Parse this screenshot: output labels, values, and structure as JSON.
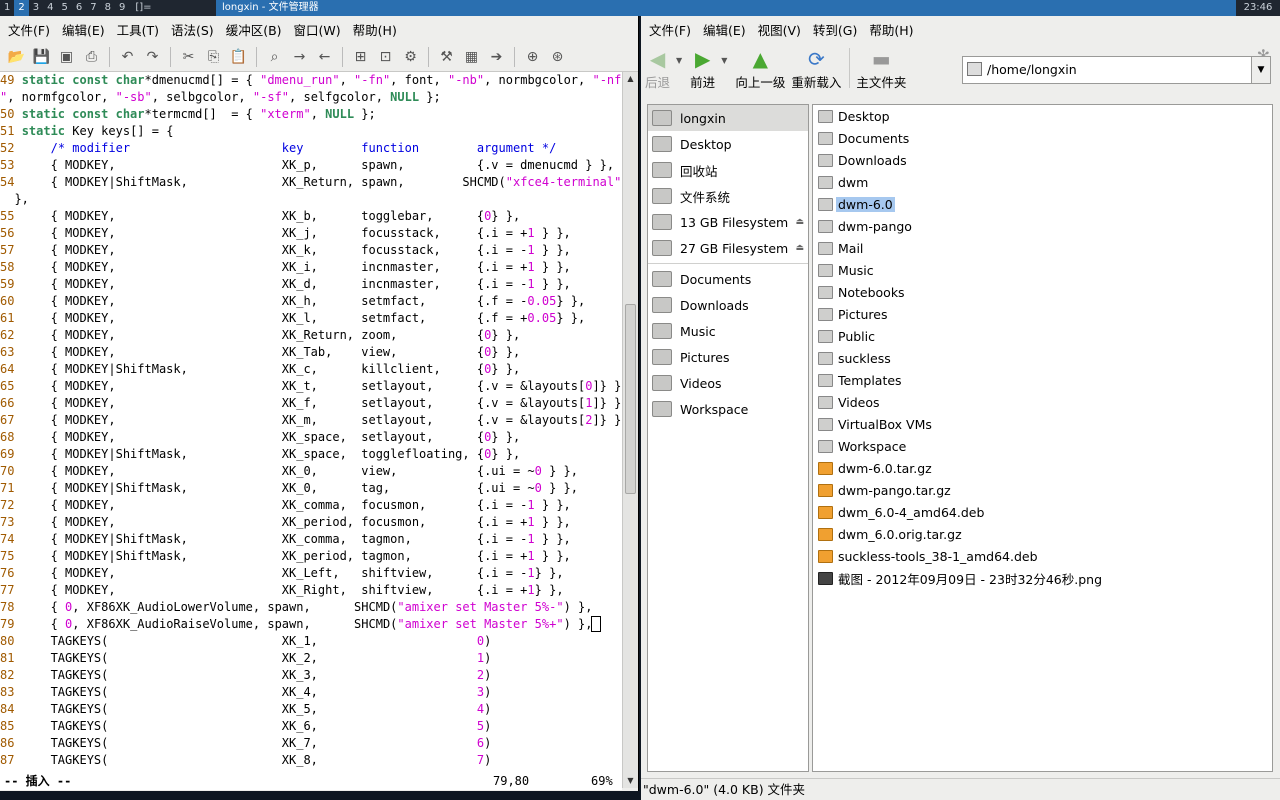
{
  "topbar": {
    "tags": [
      "1",
      "2",
      "3",
      "4",
      "5",
      "6",
      "7",
      "8",
      "9"
    ],
    "selected_tag": "2",
    "layout_symbol": "[]=",
    "window_title": "longxin - 文件管理器",
    "clock": "23:46"
  },
  "editor": {
    "menu": [
      "文件(F)",
      "编辑(E)",
      "工具(T)",
      "语法(S)",
      "缓冲区(B)",
      "窗口(W)",
      "帮助(H)"
    ],
    "toolbar_icons": [
      "open-icon",
      "save-icon",
      "save-all-icon",
      "print-icon",
      "undo-icon",
      "redo-icon",
      "cut-icon",
      "copy-icon",
      "paste-icon",
      "find-replace-icon",
      "find-next-icon",
      "find-prev-icon",
      "load-session-icon",
      "save-session-icon",
      "run-script-icon",
      "make-icon",
      "run-ctags-icon",
      "jump-tag-icon",
      "help-icon",
      "find-help-icon"
    ],
    "code_lines": [
      [
        [
          "ln",
          "49 "
        ],
        [
          "kw",
          "static const char"
        ],
        [
          "",
          "*dmenucmd[] = { "
        ],
        [
          "st",
          "\"dmenu_run\""
        ],
        [
          "",
          ", "
        ],
        [
          "st",
          "\"-fn\""
        ],
        [
          "",
          ", font, "
        ],
        [
          "st",
          "\"-nb\""
        ],
        [
          "",
          ", normbgcolor, "
        ],
        [
          "st",
          "\"-nf"
        ]
      ],
      [
        [
          "st",
          "\""
        ],
        [
          "",
          ", normfgcolor, "
        ],
        [
          "st",
          "\"-sb\""
        ],
        [
          "",
          ", selbgcolor, "
        ],
        [
          "st",
          "\"-sf\""
        ],
        [
          "",
          ", selfgcolor, "
        ],
        [
          "kw",
          "NULL"
        ],
        [
          "",
          " };"
        ]
      ],
      [
        [
          "ln",
          "50 "
        ],
        [
          "kw",
          "static const char"
        ],
        [
          "",
          "*termcmd[]  = { "
        ],
        [
          "st",
          "\"xterm\""
        ],
        [
          "",
          ", "
        ],
        [
          "kw",
          "NULL"
        ],
        [
          "",
          " };"
        ]
      ],
      [
        [
          "ln",
          "51 "
        ],
        [
          "kw",
          "static"
        ],
        [
          "",
          " Key keys[] = {"
        ]
      ],
      [
        [
          "ln",
          "52 "
        ],
        [
          "",
          "    "
        ],
        [
          "cm",
          "/* modifier                     key        function        argument */"
        ]
      ],
      [
        [
          "ln",
          "53 "
        ],
        [
          "",
          "    { MODKEY,                       XK_p,      spawn,          {.v = dmenucmd } },"
        ]
      ],
      [
        [
          "ln",
          "54 "
        ],
        [
          "",
          "    { MODKEY|ShiftMask,             XK_Return, spawn,        SHCMD("
        ],
        [
          "st",
          "\"xfce4-terminal\""
        ],
        [
          "",
          ")"
        ]
      ],
      [
        [
          "",
          "  },"
        ]
      ],
      [
        [
          "ln",
          "55 "
        ],
        [
          "",
          "    { MODKEY,                       XK_b,      togglebar,      {"
        ],
        [
          "nu",
          "0"
        ],
        [
          "",
          "} },"
        ]
      ],
      [
        [
          "ln",
          "56 "
        ],
        [
          "",
          "    { MODKEY,                       XK_j,      focusstack,     {.i = +"
        ],
        [
          "nu",
          "1"
        ],
        [
          "",
          " } },"
        ]
      ],
      [
        [
          "ln",
          "57 "
        ],
        [
          "",
          "    { MODKEY,                       XK_k,      focusstack,     {.i = -"
        ],
        [
          "nu",
          "1"
        ],
        [
          "",
          " } },"
        ]
      ],
      [
        [
          "ln",
          "58 "
        ],
        [
          "",
          "    { MODKEY,                       XK_i,      incnmaster,     {.i = +"
        ],
        [
          "nu",
          "1"
        ],
        [
          "",
          " } },"
        ]
      ],
      [
        [
          "ln",
          "59 "
        ],
        [
          "",
          "    { MODKEY,                       XK_d,      incnmaster,     {.i = -"
        ],
        [
          "nu",
          "1"
        ],
        [
          "",
          " } },"
        ]
      ],
      [
        [
          "ln",
          "60 "
        ],
        [
          "",
          "    { MODKEY,                       XK_h,      setmfact,       {.f = -"
        ],
        [
          "nu",
          "0.05"
        ],
        [
          "",
          "} },"
        ]
      ],
      [
        [
          "ln",
          "61 "
        ],
        [
          "",
          "    { MODKEY,                       XK_l,      setmfact,       {.f = +"
        ],
        [
          "nu",
          "0.05"
        ],
        [
          "",
          "} },"
        ]
      ],
      [
        [
          "ln",
          "62 "
        ],
        [
          "",
          "    { MODKEY,                       XK_Return, zoom,           {"
        ],
        [
          "nu",
          "0"
        ],
        [
          "",
          "} },"
        ]
      ],
      [
        [
          "ln",
          "63 "
        ],
        [
          "",
          "    { MODKEY,                       XK_Tab,    view,           {"
        ],
        [
          "nu",
          "0"
        ],
        [
          "",
          "} },"
        ]
      ],
      [
        [
          "ln",
          "64 "
        ],
        [
          "",
          "    { MODKEY|ShiftMask,             XK_c,      killclient,     {"
        ],
        [
          "nu",
          "0"
        ],
        [
          "",
          "} },"
        ]
      ],
      [
        [
          "ln",
          "65 "
        ],
        [
          "",
          "    { MODKEY,                       XK_t,      setlayout,      {.v = &layouts["
        ],
        [
          "nu",
          "0"
        ],
        [
          "",
          "]} },"
        ]
      ],
      [
        [
          "ln",
          "66 "
        ],
        [
          "",
          "    { MODKEY,                       XK_f,      setlayout,      {.v = &layouts["
        ],
        [
          "nu",
          "1"
        ],
        [
          "",
          "]} },"
        ]
      ],
      [
        [
          "ln",
          "67 "
        ],
        [
          "",
          "    { MODKEY,                       XK_m,      setlayout,      {.v = &layouts["
        ],
        [
          "nu",
          "2"
        ],
        [
          "",
          "]} },"
        ]
      ],
      [
        [
          "ln",
          "68 "
        ],
        [
          "",
          "    { MODKEY,                       XK_space,  setlayout,      {"
        ],
        [
          "nu",
          "0"
        ],
        [
          "",
          "} },"
        ]
      ],
      [
        [
          "ln",
          "69 "
        ],
        [
          "",
          "    { MODKEY|ShiftMask,             XK_space,  togglefloating, {"
        ],
        [
          "nu",
          "0"
        ],
        [
          "",
          "} },"
        ]
      ],
      [
        [
          "ln",
          "70 "
        ],
        [
          "",
          "    { MODKEY,                       XK_0,      view,           {.ui = ~"
        ],
        [
          "nu",
          "0"
        ],
        [
          "",
          " } },"
        ]
      ],
      [
        [
          "ln",
          "71 "
        ],
        [
          "",
          "    { MODKEY|ShiftMask,             XK_0,      tag,            {.ui = ~"
        ],
        [
          "nu",
          "0"
        ],
        [
          "",
          " } },"
        ]
      ],
      [
        [
          "ln",
          "72 "
        ],
        [
          "",
          "    { MODKEY,                       XK_comma,  focusmon,       {.i = -"
        ],
        [
          "nu",
          "1"
        ],
        [
          "",
          " } },"
        ]
      ],
      [
        [
          "ln",
          "73 "
        ],
        [
          "",
          "    { MODKEY,                       XK_period, focusmon,       {.i = +"
        ],
        [
          "nu",
          "1"
        ],
        [
          "",
          " } },"
        ]
      ],
      [
        [
          "ln",
          "74 "
        ],
        [
          "",
          "    { MODKEY|ShiftMask,             XK_comma,  tagmon,         {.i = -"
        ],
        [
          "nu",
          "1"
        ],
        [
          "",
          " } },"
        ]
      ],
      [
        [
          "ln",
          "75 "
        ],
        [
          "",
          "    { MODKEY|ShiftMask,             XK_period, tagmon,         {.i = +"
        ],
        [
          "nu",
          "1"
        ],
        [
          "",
          " } },"
        ]
      ],
      [
        [
          "ln",
          "76 "
        ],
        [
          "",
          "    { MODKEY,                       XK_Left,   shiftview,      {.i = -"
        ],
        [
          "nu",
          "1"
        ],
        [
          "",
          "} },"
        ]
      ],
      [
        [
          "ln",
          "77 "
        ],
        [
          "",
          "    { MODKEY,                       XK_Right,  shiftview,      {.i = +"
        ],
        [
          "nu",
          "1"
        ],
        [
          "",
          "} },"
        ]
      ],
      [
        [
          "ln",
          "78 "
        ],
        [
          "",
          "    { "
        ],
        [
          "nu",
          "0"
        ],
        [
          "",
          ", XF86XK_AudioLowerVolume, spawn,      SHCMD("
        ],
        [
          "st",
          "\"amixer set Master 5%-\""
        ],
        [
          "",
          ") },"
        ]
      ],
      [
        [
          "ln",
          "79 "
        ],
        [
          "",
          "    { "
        ],
        [
          "nu",
          "0"
        ],
        [
          "",
          ", XF86XK_AudioRaiseVolume, spawn,      SHCMD("
        ],
        [
          "st",
          "\"amixer set Master 5%+\""
        ],
        [
          "",
          ") },"
        ],
        [
          "cur",
          " "
        ]
      ],
      [
        [
          "ln",
          "80 "
        ],
        [
          "",
          "    TAGKEYS(                        XK_1,                      "
        ],
        [
          "nu",
          "0"
        ],
        [
          "",
          ")"
        ]
      ],
      [
        [
          "ln",
          "81 "
        ],
        [
          "",
          "    TAGKEYS(                        XK_2,                      "
        ],
        [
          "nu",
          "1"
        ],
        [
          "",
          ")"
        ]
      ],
      [
        [
          "ln",
          "82 "
        ],
        [
          "",
          "    TAGKEYS(                        XK_3,                      "
        ],
        [
          "nu",
          "2"
        ],
        [
          "",
          ")"
        ]
      ],
      [
        [
          "ln",
          "83 "
        ],
        [
          "",
          "    TAGKEYS(                        XK_4,                      "
        ],
        [
          "nu",
          "3"
        ],
        [
          "",
          ")"
        ]
      ],
      [
        [
          "ln",
          "84 "
        ],
        [
          "",
          "    TAGKEYS(                        XK_5,                      "
        ],
        [
          "nu",
          "4"
        ],
        [
          "",
          ")"
        ]
      ],
      [
        [
          "ln",
          "85 "
        ],
        [
          "",
          "    TAGKEYS(                        XK_6,                      "
        ],
        [
          "nu",
          "5"
        ],
        [
          "",
          ")"
        ]
      ],
      [
        [
          "ln",
          "86 "
        ],
        [
          "",
          "    TAGKEYS(                        XK_7,                      "
        ],
        [
          "nu",
          "6"
        ],
        [
          "",
          ")"
        ]
      ],
      [
        [
          "ln",
          "87 "
        ],
        [
          "",
          "    TAGKEYS(                        XK_8,                      "
        ],
        [
          "nu",
          "7"
        ],
        [
          "",
          ")"
        ]
      ]
    ],
    "status_mode": "-- 插入 --",
    "status_pos": "79,80",
    "status_pct": "69%"
  },
  "filemanager": {
    "menu": [
      "文件(F)",
      "编辑(E)",
      "视图(V)",
      "转到(G)",
      "帮助(H)"
    ],
    "nav": {
      "back": "后退",
      "forward": "前进",
      "up": "向上一级",
      "reload": "重新载入",
      "home": "主文件夹"
    },
    "path": "/home/longxin",
    "side_places": [
      {
        "label": "longxin",
        "selected": true
      },
      {
        "label": "Desktop"
      },
      {
        "label": "回收站"
      },
      {
        "label": "文件系统"
      },
      {
        "label": "13 GB Filesystem",
        "eject": true
      },
      {
        "label": "27 GB Filesystem",
        "eject": true
      }
    ],
    "side_bookmarks": [
      {
        "label": "Documents"
      },
      {
        "label": "Downloads"
      },
      {
        "label": "Music"
      },
      {
        "label": "Pictures"
      },
      {
        "label": "Videos"
      },
      {
        "label": "Workspace"
      }
    ],
    "files": [
      {
        "name": "Desktop",
        "kind": "folder"
      },
      {
        "name": "Documents",
        "kind": "folder"
      },
      {
        "name": "Downloads",
        "kind": "folder"
      },
      {
        "name": "dwm",
        "kind": "folder"
      },
      {
        "name": "dwm-6.0",
        "kind": "folder",
        "selected": true
      },
      {
        "name": "dwm-pango",
        "kind": "folder"
      },
      {
        "name": "Mail",
        "kind": "folder"
      },
      {
        "name": "Music",
        "kind": "folder"
      },
      {
        "name": "Notebooks",
        "kind": "folder"
      },
      {
        "name": "Pictures",
        "kind": "folder"
      },
      {
        "name": "Public",
        "kind": "folder"
      },
      {
        "name": "suckless",
        "kind": "folder"
      },
      {
        "name": "Templates",
        "kind": "folder"
      },
      {
        "name": "Videos",
        "kind": "folder"
      },
      {
        "name": "VirtualBox VMs",
        "kind": "folder"
      },
      {
        "name": "Workspace",
        "kind": "folder"
      },
      {
        "name": "dwm-6.0.tar.gz",
        "kind": "arc"
      },
      {
        "name": "dwm-pango.tar.gz",
        "kind": "arc"
      },
      {
        "name": "dwm_6.0-4_amd64.deb",
        "kind": "deb"
      },
      {
        "name": "dwm_6.0.orig.tar.gz",
        "kind": "arc"
      },
      {
        "name": "suckless-tools_38-1_amd64.deb",
        "kind": "deb"
      },
      {
        "name": "截图 - 2012年09月09日 - 23时32分46秒.png",
        "kind": "img"
      }
    ],
    "status": "\"dwm-6.0\" (4.0 KB) 文件夹"
  }
}
